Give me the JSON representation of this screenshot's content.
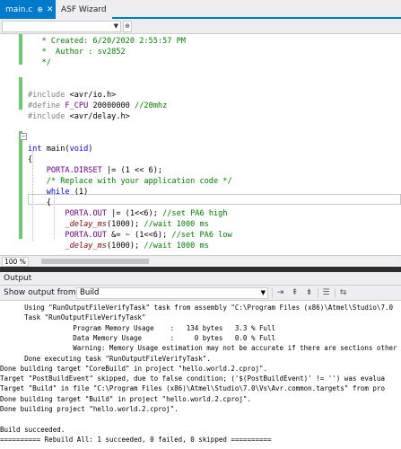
{
  "tabs": [
    {
      "label": "main.c",
      "pin": "⊕",
      "close": "✕"
    },
    {
      "label": "ASF Wizard"
    }
  ],
  "code": [
    {
      "kind": "cm",
      "text": "   * Created: 6/20/2020 2:55:57 PM"
    },
    {
      "kind": "cm",
      "text": "   *  Author : sv2852"
    },
    {
      "kind": "cm",
      "text": "   */"
    },
    {
      "kind": "blank",
      "text": ""
    },
    {
      "kind": "blank",
      "text": ""
    },
    {
      "kind": "include",
      "directive": "#include",
      "arg": " <avr/io.h>"
    },
    {
      "kind": "define",
      "directive": "#define",
      "name": "F_CPU",
      "value": " 20000000 ",
      "comment": "//20mhz"
    },
    {
      "kind": "include",
      "directive": "#include",
      "arg": " <avr/delay.h>"
    },
    {
      "kind": "blank",
      "text": ""
    },
    {
      "kind": "blank",
      "text": ""
    },
    {
      "kind": "main",
      "type": "int",
      "name": " main(",
      "arg": "void",
      ")": ")"
    },
    {
      "kind": "plain",
      "text": "{"
    },
    {
      "kind": "assign",
      "indent": "    ",
      "lhs": "PORTA.DIRSET",
      "rhs": " |= (1 << 6);"
    },
    {
      "kind": "cm",
      "indent": "    ",
      "text": "/* Replace with your application code */"
    },
    {
      "kind": "while",
      "indent": "    ",
      "kw": "while",
      "rest": " (1)"
    },
    {
      "kind": "plain",
      "text": "    {"
    },
    {
      "kind": "stmt",
      "indent": "        ",
      "lhs": "PORTA.OUT",
      "rhs": " |= (1<<6); ",
      "comment": "//set PA6 high"
    },
    {
      "kind": "call",
      "indent": "        ",
      "fn": "_delay_ms",
      "rhs": "(1000); ",
      "comment": "//wait 1000 ms"
    },
    {
      "kind": "stmt",
      "indent": "        ",
      "lhs": "PORTA.OUT",
      "rhs": " &= ~ (1<<6); ",
      "comment": "//set PA6 low"
    },
    {
      "kind": "call",
      "indent": "        ",
      "fn": "_delay_ms",
      "rhs": "(1000); ",
      "comment": "//wait 1000 ms"
    }
  ],
  "editor": {
    "zoom": "100 %"
  },
  "output": {
    "title": "Output",
    "show_from_label": "Show output from:",
    "source": "Build",
    "lines": [
      "      Using \"RunOutputFileVerifyTask\" task from assembly \"C:\\Program Files (x86)\\Atmel\\Studio\\7.0",
      "      Task \"RunOutputFileVerifyTask\"",
      "                  Program Memory Usage    :   134 bytes   3.3 % Full",
      "                  Data Memory Usage       :     0 bytes   0.0 % Full",
      "                  Warning: Memory Usage estimation may not be accurate if there are sections other",
      "      Done executing task \"RunOutputFileVerifyTask\".",
      "Done building target \"CoreBuild\" in project \"hello.world.2.cproj\".",
      "Target \"PostBuildEvent\" skipped, due to false condition; ('$(PostBuildEvent)' != '') was evalua",
      "Target \"Build\" in file \"C:\\Program Files (x86)\\Atmel\\Studio\\7.0\\Vs\\Avr.common.targets\" from pro",
      "Done building target \"Build\" in project \"hello.world.2.cproj\".",
      "Done building project \"hello.world.2.cproj\".",
      "",
      "Build succeeded.",
      "========== Rebuild All: 1 succeeded, 0 failed, 0 skipped =========="
    ]
  }
}
